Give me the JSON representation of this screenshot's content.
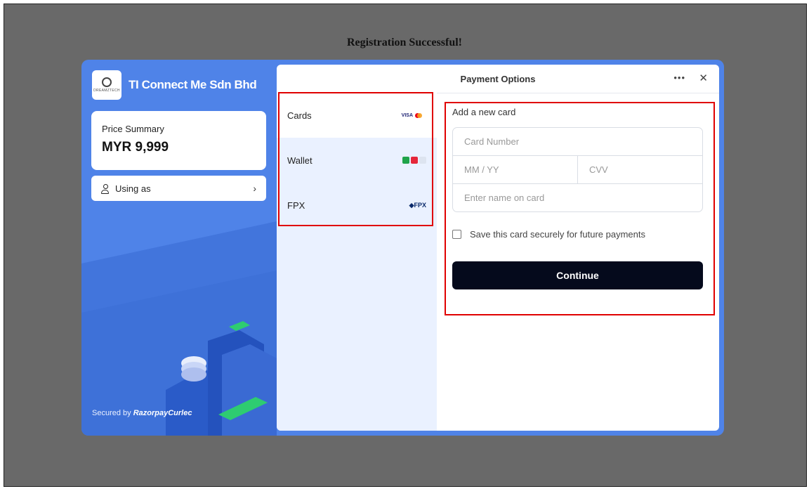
{
  "page": {
    "title": "Registration Successful!"
  },
  "checkout": {
    "merchant": {
      "name": "TI Connect Me Sdn Bhd",
      "logo_caption": "DREAMZTECH"
    },
    "price_summary": {
      "label": "Price Summary",
      "amount": "MYR 9,999"
    },
    "using_as": {
      "label": "Using as"
    },
    "secured_by": {
      "prefix": "Secured by",
      "brand": "RazorpayCurlec"
    },
    "colors": {
      "brand_blue": "#4f83e8",
      "continue_bg": "#050a1c",
      "highlight": "#e00000"
    }
  },
  "payment": {
    "title": "Payment Options",
    "methods": [
      {
        "name": "Cards",
        "icon": "visa-mastercard-icon"
      },
      {
        "name": "Wallet",
        "icon": "wallet-logos-icon"
      },
      {
        "name": "FPX",
        "icon": "fpx-logo-icon"
      }
    ],
    "fpx_logo_text": "FPX",
    "visa_text": "VISA",
    "form": {
      "heading": "Add a new card",
      "card_number_placeholder": "Card Number",
      "expiry_placeholder": "MM / YY",
      "cvv_placeholder": "CVV",
      "name_placeholder": "Enter name on card",
      "save_label": "Save this card securely for future payments",
      "save_checked": false,
      "continue_label": "Continue"
    }
  }
}
